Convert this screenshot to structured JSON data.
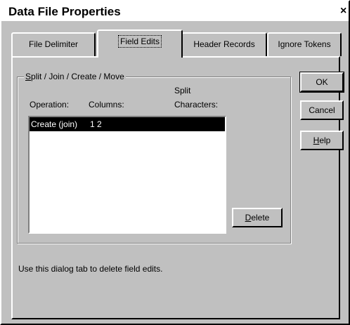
{
  "window": {
    "title": "Data File Properties",
    "close_glyph": "×"
  },
  "tabs": [
    {
      "label": "File Delimiter",
      "active": false
    },
    {
      "label": "Field Edits",
      "active": true
    },
    {
      "label": "Header Records",
      "active": false
    },
    {
      "label": "Ignore Tokens",
      "active": false
    }
  ],
  "group": {
    "legend": "Split / Join / Create / Move",
    "legend_mnemonic": "S",
    "legend_rest": "plit / Join / Create / Move",
    "headers": {
      "operation": "Operation:",
      "columns": "Columns:",
      "split_line1": "Split",
      "split_line2": "Characters:"
    },
    "rows": [
      {
        "operation": "Create (join)",
        "columns": "1 2",
        "split": "",
        "selected": true
      }
    ],
    "delete_mnemonic": "D",
    "delete_rest": "elete"
  },
  "buttons": {
    "ok": "OK",
    "cancel": "Cancel",
    "help_mnemonic": "H",
    "help_rest": "elp"
  },
  "status": "Use this dialog tab to delete field edits."
}
